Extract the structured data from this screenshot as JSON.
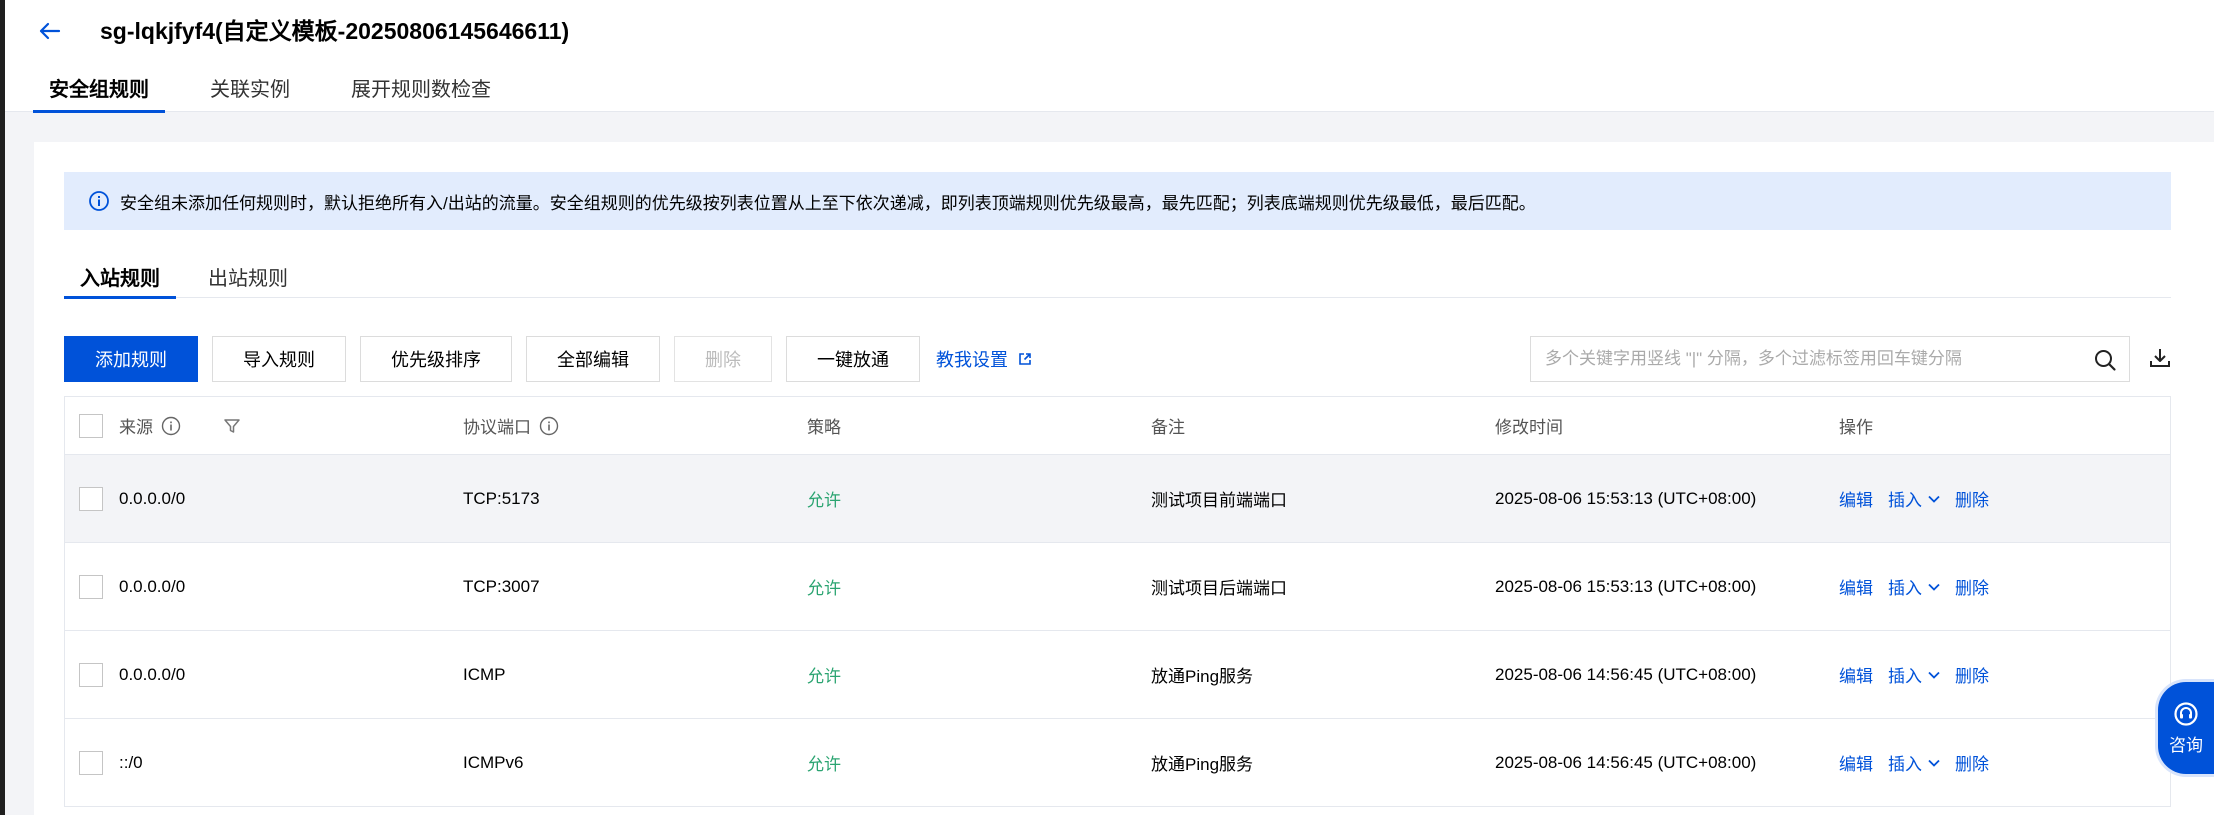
{
  "header": {
    "title": "sg-lqkjfyf4(自定义模板-20250806145646611)"
  },
  "main_tabs": [
    {
      "label": "安全组规则",
      "active": true
    },
    {
      "label": "关联实例",
      "active": false
    },
    {
      "label": "展开规则数检查",
      "active": false
    }
  ],
  "notice": {
    "text": "安全组未添加任何规则时，默认拒绝所有入/出站的流量。安全组规则的优先级按列表位置从上至下依次递减，即列表顶端规则优先级最高，最先匹配；列表底端规则优先级最低，最后匹配。"
  },
  "sub_tabs": [
    {
      "label": "入站规则",
      "active": true
    },
    {
      "label": "出站规则",
      "active": false
    }
  ],
  "toolbar": {
    "add": "添加规则",
    "import": "导入规则",
    "priority": "优先级排序",
    "edit_all": "全部编辑",
    "delete": "删除",
    "one_click": "一键放通",
    "guide": "教我设置"
  },
  "search": {
    "placeholder": "多个关键字用竖线 \"|\" 分隔，多个过滤标签用回车键分隔",
    "value": ""
  },
  "table": {
    "headers": {
      "source": "来源",
      "port": "协议端口",
      "policy": "策略",
      "note": "备注",
      "time": "修改时间",
      "ops": "操作"
    },
    "rows": [
      {
        "source": "0.0.0.0/0",
        "port": "TCP:5173",
        "policy": "允许",
        "note": "测试项目前端端口",
        "time": "2025-08-06 15:53:13 (UTC+08:00)"
      },
      {
        "source": "0.0.0.0/0",
        "port": "TCP:3007",
        "policy": "允许",
        "note": "测试项目后端端口",
        "time": "2025-08-06 15:53:13 (UTC+08:00)"
      },
      {
        "source": "0.0.0.0/0",
        "port": "ICMP",
        "policy": "允许",
        "note": "放通Ping服务",
        "time": "2025-08-06 14:56:45 (UTC+08:00)"
      },
      {
        "source": "::/0",
        "port": "ICMPv6",
        "policy": "允许",
        "note": "放通Ping服务",
        "time": "2025-08-06 14:56:45 (UTC+08:00)"
      }
    ],
    "ops": {
      "edit": "编辑",
      "insert": "插入",
      "delete": "删除"
    }
  },
  "consult": {
    "label": "咨询"
  },
  "colors": {
    "primary": "#0052d9",
    "allow": "#2ba471",
    "notice_bg": "#e2ecfd"
  }
}
